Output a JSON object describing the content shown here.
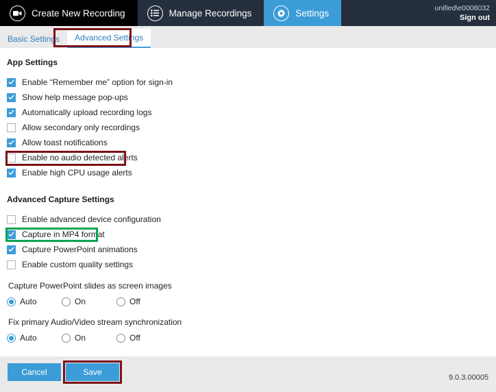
{
  "topnav": {
    "items": [
      {
        "label": "Create New Recording",
        "icon": "video-camera-icon",
        "state": "inactive-dark"
      },
      {
        "label": "Manage Recordings",
        "icon": "list-icon",
        "state": "inactive"
      },
      {
        "label": "Settings",
        "icon": "gear-icon",
        "state": "active"
      }
    ],
    "user": "unified\\e0008032",
    "sign_out": "Sign out"
  },
  "tabs": [
    {
      "label": "Basic Settings",
      "active": false
    },
    {
      "label": "Advanced Settings",
      "active": true,
      "highlight": "red"
    }
  ],
  "sections": {
    "app_settings": {
      "title": "App Settings",
      "checkboxes": [
        {
          "label": "Enable “Remember me” option for sign-in",
          "checked": true
        },
        {
          "label": "Show help message pop-ups",
          "checked": true
        },
        {
          "label": "Automatically upload recording logs",
          "checked": true
        },
        {
          "label": "Allow secondary only recordings",
          "checked": false
        },
        {
          "label": "Allow toast notifications",
          "checked": true
        },
        {
          "label": "Enable no audio detected alerts",
          "checked": false,
          "highlight": "red"
        },
        {
          "label": "Enable high CPU usage alerts",
          "checked": true
        }
      ]
    },
    "advanced_capture_settings": {
      "title": "Advanced Capture Settings",
      "checkboxes": [
        {
          "label": "Enable advanced device configuration",
          "checked": false
        },
        {
          "label": "Capture in MP4 format",
          "checked": true,
          "highlight": "green"
        },
        {
          "label": "Capture PowerPoint animations",
          "checked": true
        },
        {
          "label": "Enable custom quality settings",
          "checked": false
        }
      ],
      "radio_groups": [
        {
          "label": "Capture PowerPoint slides as screen images",
          "options": [
            "Auto",
            "On",
            "Off"
          ],
          "selected": "Auto"
        },
        {
          "label": "Fix primary Audio/Video stream synchronization",
          "options": [
            "Auto",
            "On",
            "Off"
          ],
          "selected": "Auto"
        }
      ]
    }
  },
  "footer": {
    "cancel_label": "Cancel",
    "save_label": "Save",
    "save_highlight": "red",
    "version": "9.0.3.00005"
  },
  "colors": {
    "accent_blue": "#3c9cd7",
    "nav_dark": "#000000",
    "nav_dark2": "#252f3e",
    "highlight_red": "#7b1018",
    "highlight_green": "#09a650",
    "panel_gray": "#eaeaea"
  }
}
